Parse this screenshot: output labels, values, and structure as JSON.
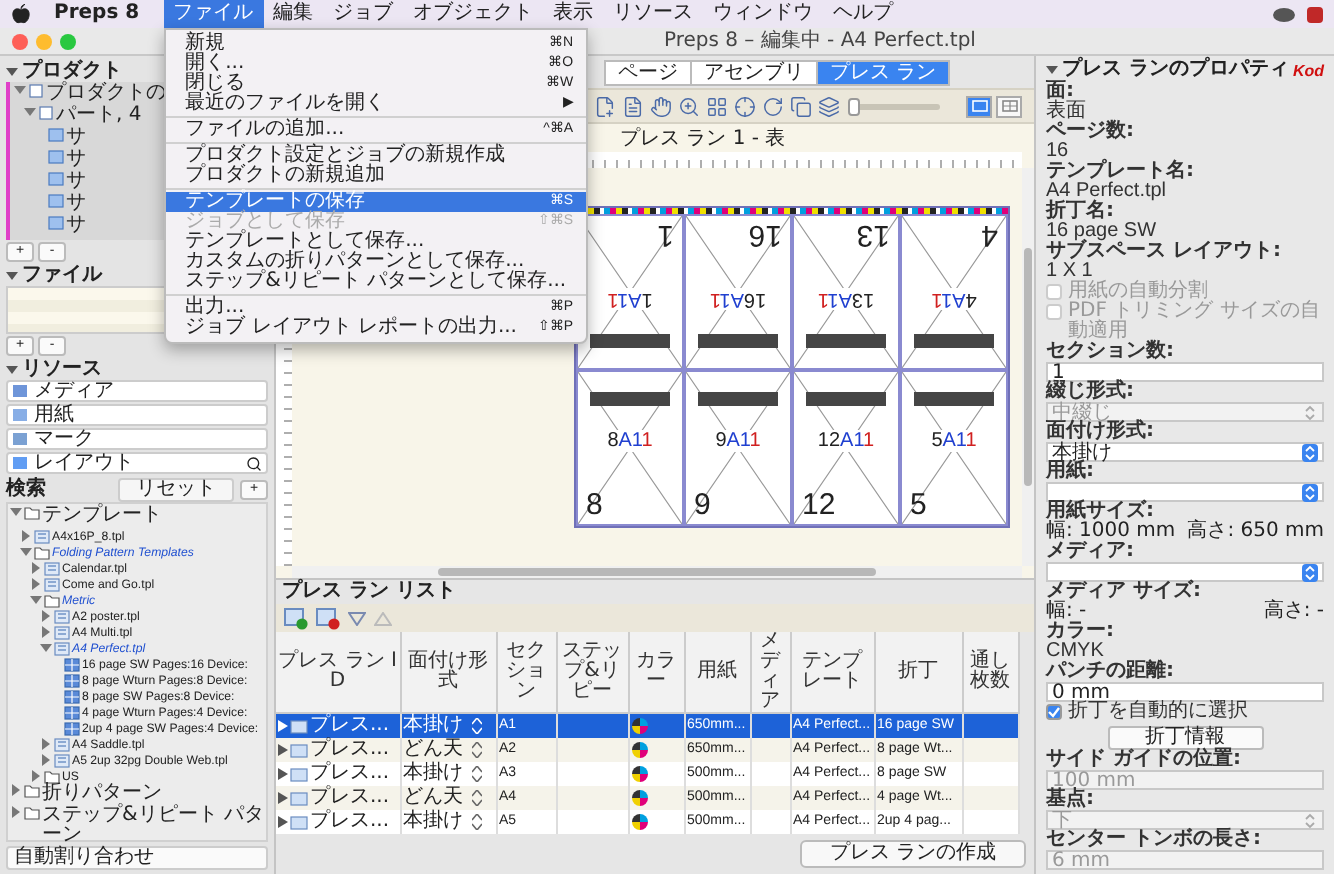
{
  "menu_bar": {
    "app": "Preps 8",
    "menus": [
      {
        "label": "ファイル",
        "selected": true
      },
      {
        "label": "編集",
        "selected": false
      },
      {
        "label": "ジョブ",
        "selected": false
      },
      {
        "label": "オブジェクト",
        "selected": false
      },
      {
        "label": "表示",
        "selected": false
      },
      {
        "label": "リソース",
        "selected": false
      },
      {
        "label": "ウィンドウ",
        "selected": false
      },
      {
        "label": "ヘルプ",
        "selected": false
      }
    ]
  },
  "window": {
    "title": "Preps 8 – 編集中 - A4 Perfect.tpl"
  },
  "file_menu": {
    "items": [
      {
        "kind": "item",
        "label": "新規",
        "shortcut": "⌘N",
        "selected": false,
        "disabled": false
      },
      {
        "kind": "item",
        "label": "開く...",
        "shortcut": "⌘O",
        "selected": false,
        "disabled": false
      },
      {
        "kind": "item",
        "label": "閉じる",
        "shortcut": "⌘W",
        "selected": false,
        "disabled": false
      },
      {
        "kind": "item",
        "label": "最近のファイルを開く",
        "shortcut": "▶",
        "selected": false,
        "disabled": false
      },
      {
        "kind": "separator"
      },
      {
        "kind": "item",
        "label": "ファイルの追加...",
        "shortcut": "^⌘A",
        "selected": false,
        "disabled": false
      },
      {
        "kind": "separator"
      },
      {
        "kind": "item",
        "label": "プロダクト設定とジョブの新規作成",
        "selected": false,
        "disabled": false
      },
      {
        "kind": "item",
        "label": "プロダクトの新規追加",
        "selected": false,
        "disabled": false
      },
      {
        "kind": "separator"
      },
      {
        "kind": "item",
        "label": "テンプレートの保存",
        "shortcut": "⌘S",
        "selected": true,
        "disabled": false
      },
      {
        "kind": "item",
        "label": "ジョブとして保存",
        "shortcut": "⇧⌘S",
        "selected": false,
        "disabled": true
      },
      {
        "kind": "item",
        "label": "テンプレートとして保存...",
        "selected": false,
        "disabled": false
      },
      {
        "kind": "item",
        "label": "カスタムの折りパターンとして保存...",
        "selected": false,
        "disabled": false
      },
      {
        "kind": "item",
        "label": "ステップ&リピート パターンとして保存...",
        "selected": false,
        "disabled": false
      },
      {
        "kind": "separator"
      },
      {
        "kind": "item",
        "label": "出力...",
        "shortcut": "⌘P",
        "selected": false,
        "disabled": false
      },
      {
        "kind": "item",
        "label": "ジョブ レイアウト レポートの出力...",
        "shortcut": "⇧⌘P",
        "selected": false,
        "disabled": false
      }
    ]
  },
  "product_panel": {
    "title": "プロダクト",
    "tree": [
      {
        "label": "プロダクトの",
        "kind": "product",
        "expanded": true,
        "children": [
          {
            "label": "パート, 4",
            "kind": "part",
            "expanded": true,
            "children": [
              {
                "label": "サ",
                "kind": "signature"
              },
              {
                "label": "サ",
                "kind": "signature"
              },
              {
                "label": "サ",
                "kind": "signature"
              },
              {
                "label": "サ",
                "kind": "signature"
              },
              {
                "label": "サ",
                "kind": "signature"
              }
            ]
          }
        ]
      }
    ],
    "buttons": [
      "+",
      "-"
    ]
  },
  "file_panel": {
    "title": "ファイル",
    "buttons": [
      "+",
      "-"
    ]
  },
  "resources_panel": {
    "title": "リソース",
    "categories": [
      {
        "label": "メディア",
        "kind": "media"
      },
      {
        "label": "用紙",
        "kind": "paper"
      },
      {
        "label": "マーク",
        "kind": "mark"
      },
      {
        "label": "レイアウト",
        "kind": "layout"
      }
    ],
    "search_label": "検索",
    "reset_button": "リセット",
    "add_button": "+",
    "tree": [
      {
        "label": "テンプレート",
        "kind": "folder",
        "expanded": true,
        "in_use": false,
        "children": [
          {
            "label": "A4x16P_8.tpl",
            "kind": "template",
            "expanded": false,
            "in_use": false
          },
          {
            "label": "Folding Pattern Templates",
            "kind": "folder",
            "expanded": true,
            "in_use": true,
            "children": [
              {
                "label": "Calendar.tpl",
                "kind": "template",
                "expanded": false,
                "in_use": false
              },
              {
                "label": "Come and Go.tpl",
                "kind": "template",
                "expanded": false,
                "in_use": false
              },
              {
                "label": "Metric",
                "kind": "folder",
                "expanded": true,
                "in_use": true,
                "children": [
                  {
                    "label": "A2 poster.tpl",
                    "kind": "template",
                    "expanded": false,
                    "in_use": false
                  },
                  {
                    "label": "A4 Multi.tpl",
                    "kind": "template",
                    "expanded": false,
                    "in_use": false
                  },
                  {
                    "label": "A4 Perfect.tpl",
                    "kind": "template",
                    "expanded": true,
                    "in_use": true,
                    "children": [
                      {
                        "label": "16 page SW Pages:16 Device:",
                        "kind": "fold"
                      },
                      {
                        "label": "8 page Wturn Pages:8 Device:",
                        "kind": "fold"
                      },
                      {
                        "label": "8 page SW Pages:8 Device:",
                        "kind": "fold"
                      },
                      {
                        "label": "4 page Wturn Pages:4 Device:",
                        "kind": "fold"
                      },
                      {
                        "label": "2up 4 page SW Pages:4 Device:",
                        "kind": "fold"
                      }
                    ]
                  },
                  {
                    "label": "A4 Saddle.tpl",
                    "kind": "template",
                    "expanded": false,
                    "in_use": false
                  },
                  {
                    "label": "A5 2up 32pg Double Web.tpl",
                    "kind": "template",
                    "expanded": false,
                    "in_use": false
                  }
                ]
              },
              {
                "label": "US",
                "kind": "folder",
                "expanded": false,
                "in_use": false
              }
            ]
          }
        ]
      },
      {
        "label": "折りパターン",
        "kind": "folder",
        "expanded": false,
        "in_use": false
      },
      {
        "label": "ステップ&リピート パターン",
        "kind": "folder",
        "expanded": false,
        "in_use": false
      }
    ],
    "auto_button": "自動割り合わせ"
  },
  "center": {
    "tabs": [
      {
        "label": "ページ",
        "selected": false
      },
      {
        "label": "アセンブリ",
        "selected": false
      },
      {
        "label": "プレス ラン",
        "selected": true
      }
    ],
    "zoom": {
      "level": 0.03
    },
    "view_modes": [
      {
        "selected": true
      },
      {
        "selected": false
      }
    ],
    "sheet_title": "プレス ラン 1 - 表",
    "pages": [
      {
        "number": "1",
        "label_number": "1",
        "section": "A1",
        "sheet": "1",
        "flipped": true
      },
      {
        "number": "16",
        "label_number": "16",
        "section": "A1",
        "sheet": "1",
        "flipped": true
      },
      {
        "number": "13",
        "label_number": "13",
        "section": "A1",
        "sheet": "1",
        "flipped": true
      },
      {
        "number": "4",
        "label_number": "4",
        "section": "A1",
        "sheet": "1",
        "flipped": true
      },
      {
        "number": "8",
        "label_number": "8",
        "section": "A1",
        "sheet": "1",
        "flipped": false
      },
      {
        "number": "9",
        "label_number": "9",
        "section": "A1",
        "sheet": "1",
        "flipped": false
      },
      {
        "number": "12",
        "label_number": "12",
        "section": "A1",
        "sheet": "1",
        "flipped": false
      },
      {
        "number": "5",
        "label_number": "5",
        "section": "A1",
        "sheet": "1",
        "flipped": false
      }
    ]
  },
  "press_run_list": {
    "title": "プレス ラン リスト",
    "columns": [
      "プレス ラン ID",
      "面付け形式",
      "セクション",
      "ステップ&リピー",
      "カラー",
      "用紙",
      "メディア",
      "テンプレート",
      "折丁",
      "通し枚数"
    ],
    "rows": [
      {
        "id": "プレス...",
        "imposition": "本掛け",
        "section": "A1",
        "paper": "650mm...",
        "template": "A4 Perfect...",
        "signature": "16 page SW",
        "selected": true
      },
      {
        "id": "プレス...",
        "imposition": "どん天",
        "section": "A2",
        "paper": "650mm...",
        "template": "A4 Perfect...",
        "signature": "8 page Wt...",
        "selected": false
      },
      {
        "id": "プレス...",
        "imposition": "本掛け",
        "section": "A3",
        "paper": "500mm...",
        "template": "A4 Perfect...",
        "signature": "8 page SW",
        "selected": false
      },
      {
        "id": "プレス...",
        "imposition": "どん天",
        "section": "A4",
        "paper": "500mm...",
        "template": "A4 Perfect...",
        "signature": "4 page Wt...",
        "selected": false
      },
      {
        "id": "プレス...",
        "imposition": "本掛け",
        "section": "A5",
        "paper": "500mm...",
        "template": "A4 Perfect...",
        "signature": "2up 4 pag...",
        "selected": false
      }
    ],
    "create_button": "プレス ランの作成"
  },
  "properties": {
    "title": "プレス ランのプロパティ",
    "logo": "Kod",
    "fields": [
      {
        "kind": "info",
        "label": "面:",
        "value": "表面"
      },
      {
        "kind": "info",
        "label": "ページ数:",
        "value": "16"
      },
      {
        "kind": "info",
        "label": "テンプレート名:",
        "value": "A4 Perfect.tpl"
      },
      {
        "kind": "info",
        "label": "折丁名:",
        "value": "16 page SW"
      },
      {
        "kind": "info",
        "label": "サブスペース レイアウト:",
        "value": "1 X 1"
      },
      {
        "kind": "checkbox",
        "label": "用紙の自動分割",
        "checked": false,
        "disabled": true
      },
      {
        "kind": "checkbox",
        "label": "PDF トリミング サイズの自動適用",
        "checked": false,
        "disabled": true
      },
      {
        "kind": "text",
        "label": "セクション数:",
        "value": "1",
        "disabled": false
      },
      {
        "kind": "select",
        "label": "綴じ形式:",
        "value": "中綴じ",
        "disabled": true
      },
      {
        "kind": "select",
        "label": "面付け形式:",
        "value": "本掛け",
        "disabled": false
      },
      {
        "kind": "select",
        "label": "用紙:",
        "disabled": false
      },
      {
        "kind": "size",
        "label": "用紙サイズ:",
        "width": "幅: 1000 mm",
        "height": "高さ: 650 mm"
      },
      {
        "kind": "select",
        "label": "メディア:",
        "disabled": false
      },
      {
        "kind": "size",
        "label": "メディア サイズ:",
        "width": "幅: -",
        "height": "高さ: -"
      },
      {
        "kind": "info",
        "label": "カラー:",
        "value": "CMYK"
      },
      {
        "kind": "text",
        "label": "パンチの距離:",
        "value": "0 mm",
        "disabled": false
      },
      {
        "kind": "checkbox",
        "label": "折丁を自動的に選択",
        "checked": true,
        "disabled": false
      },
      {
        "kind": "button",
        "label": "折丁情報"
      },
      {
        "kind": "text",
        "label": "サイド ガイドの位置:",
        "value": "100 mm",
        "disabled": true
      },
      {
        "kind": "select",
        "label": "基点:",
        "value": "下",
        "disabled": true
      },
      {
        "kind": "text",
        "label": "センター トンボの長さ:",
        "value": "6 mm",
        "disabled": true
      }
    ]
  }
}
